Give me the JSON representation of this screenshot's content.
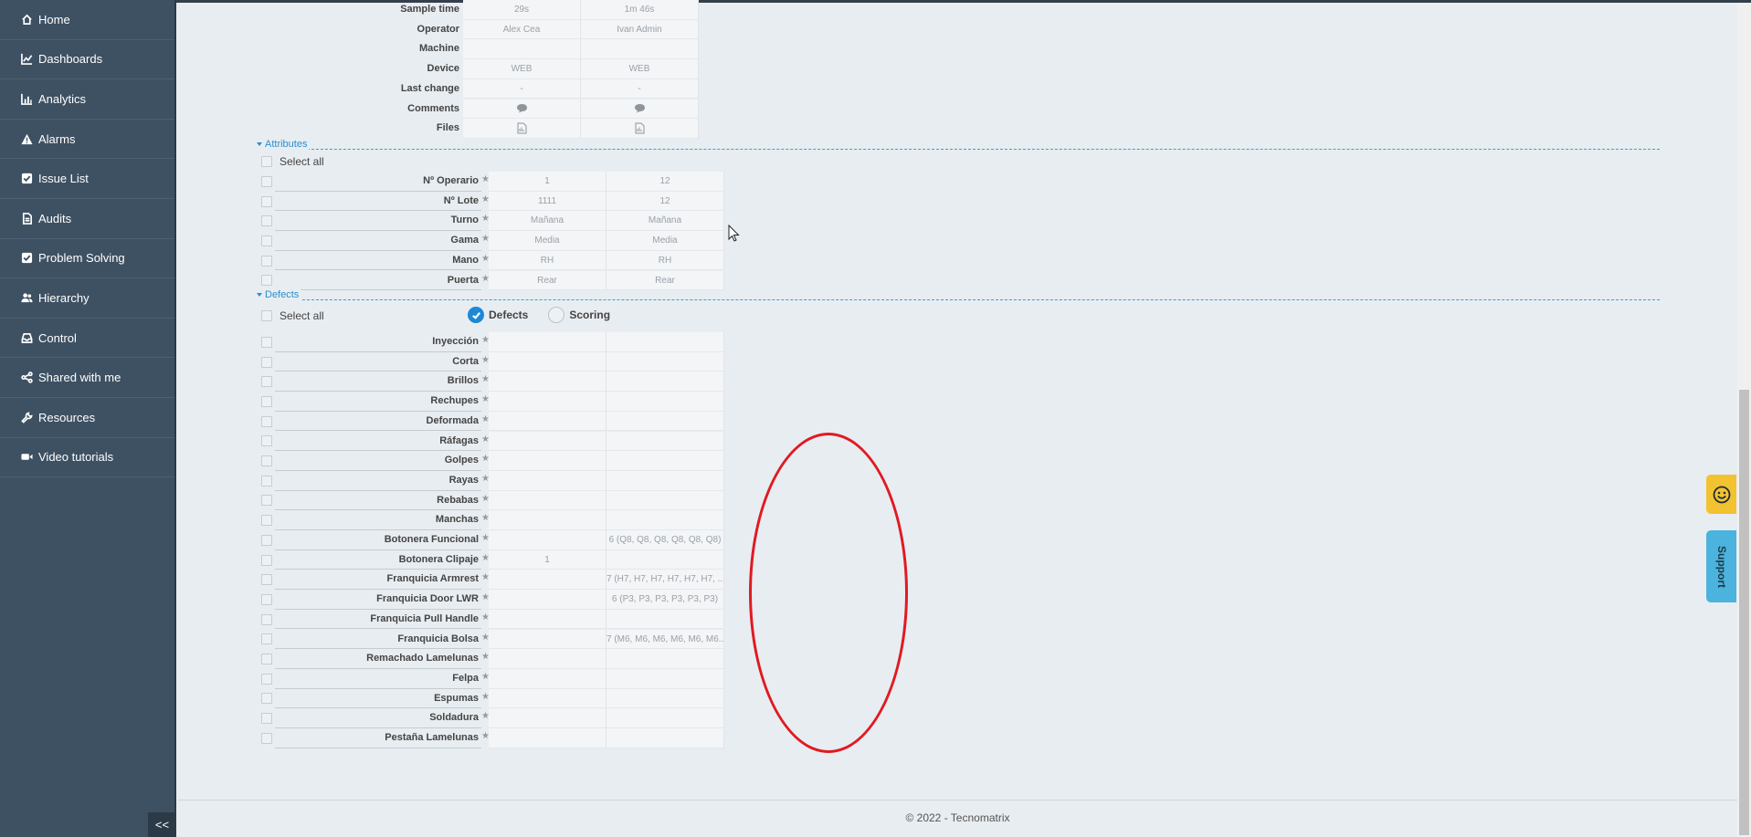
{
  "sidebar": {
    "items": [
      {
        "label": "Home",
        "icon": "home-icon"
      },
      {
        "label": "Dashboards",
        "icon": "line-chart-icon"
      },
      {
        "label": "Analytics",
        "icon": "bar-chart-icon"
      },
      {
        "label": "Alarms",
        "icon": "warning-icon"
      },
      {
        "label": "Issue List",
        "icon": "check-square-icon"
      },
      {
        "label": "Audits",
        "icon": "document-icon"
      },
      {
        "label": "Problem Solving",
        "icon": "check-square-icon"
      },
      {
        "label": "Hierarchy",
        "icon": "users-icon"
      },
      {
        "label": "Control",
        "icon": "inbox-icon"
      },
      {
        "label": "Shared with me",
        "icon": "share-icon"
      },
      {
        "label": "Resources",
        "icon": "wrench-icon"
      },
      {
        "label": "Video tutorials",
        "icon": "video-icon"
      }
    ],
    "collapse_label": "<<"
  },
  "info": [
    {
      "label": "Sample time",
      "v1": "29s",
      "v2": "1m 46s"
    },
    {
      "label": "Operator",
      "v1": "Alex Cea",
      "v2": "Ivan Admin"
    },
    {
      "label": "Machine",
      "v1": "",
      "v2": ""
    },
    {
      "label": "Device",
      "v1": "WEB",
      "v2": "WEB"
    },
    {
      "label": "Last change",
      "v1": "-",
      "v2": "-"
    },
    {
      "label": "Comments",
      "v1": "",
      "v2": ""
    },
    {
      "label": "Files",
      "v1": "",
      "v2": ""
    }
  ],
  "attributes": {
    "title": "Attributes",
    "select_all": "Select all",
    "rows": [
      {
        "label": "Nº Operario",
        "v1": "1",
        "v2": "12"
      },
      {
        "label": "Nº Lote",
        "v1": "1111",
        "v2": "12"
      },
      {
        "label": "Turno",
        "v1": "Mañana",
        "v2": "Mañana"
      },
      {
        "label": "Gama",
        "v1": "Media",
        "v2": "Media"
      },
      {
        "label": "Mano",
        "v1": "RH",
        "v2": "RH"
      },
      {
        "label": "Puerta",
        "v1": "Rear",
        "v2": "Rear"
      }
    ]
  },
  "defects": {
    "title": "Defects",
    "select_all": "Select all",
    "radio_defects": "Defects",
    "radio_scoring": "Scoring",
    "rows": [
      {
        "label": "Inyección",
        "v1": "",
        "v2": ""
      },
      {
        "label": "Corta",
        "v1": "",
        "v2": ""
      },
      {
        "label": "Brillos",
        "v1": "",
        "v2": ""
      },
      {
        "label": "Rechupes",
        "v1": "",
        "v2": ""
      },
      {
        "label": "Deformada",
        "v1": "",
        "v2": ""
      },
      {
        "label": "Ráfagas",
        "v1": "",
        "v2": ""
      },
      {
        "label": "Golpes",
        "v1": "",
        "v2": ""
      },
      {
        "label": "Rayas",
        "v1": "",
        "v2": ""
      },
      {
        "label": "Rebabas",
        "v1": "",
        "v2": ""
      },
      {
        "label": "Manchas",
        "v1": "",
        "v2": ""
      },
      {
        "label": "Botonera Funcional",
        "v1": "",
        "v2": "6 (Q8, Q8, Q8, Q8, Q8, Q8)"
      },
      {
        "label": "Botonera Clipaje",
        "v1": "1",
        "v2": ""
      },
      {
        "label": "Franquicia Armrest",
        "v1": "",
        "v2": "7 (H7, H7, H7, H7, H7, H7, ..."
      },
      {
        "label": "Franquicia Door LWR",
        "v1": "",
        "v2": "6 (P3, P3, P3, P3, P3, P3)"
      },
      {
        "label": "Franquicia Pull Handle",
        "v1": "",
        "v2": ""
      },
      {
        "label": "Franquicia Bolsa",
        "v1": "",
        "v2": "7 (M6, M6, M6, M6, M6, M6..."
      },
      {
        "label": "Remachado Lamelunas",
        "v1": "",
        "v2": ""
      },
      {
        "label": "Felpa",
        "v1": "",
        "v2": ""
      },
      {
        "label": "Espumas",
        "v1": "",
        "v2": ""
      },
      {
        "label": "Soldadura",
        "v1": "",
        "v2": ""
      },
      {
        "label": "Pestaña Lamelunas",
        "v1": "",
        "v2": ""
      }
    ]
  },
  "footer": {
    "text": "© 2022 - Tecnomatrix"
  },
  "support": {
    "label": "Support"
  },
  "colors": {
    "sidebar": "#3e5163",
    "accent": "#2a8fd0",
    "annotation": "#e01a22",
    "support": "#4bb3dd",
    "emoji": "#f2c230"
  }
}
